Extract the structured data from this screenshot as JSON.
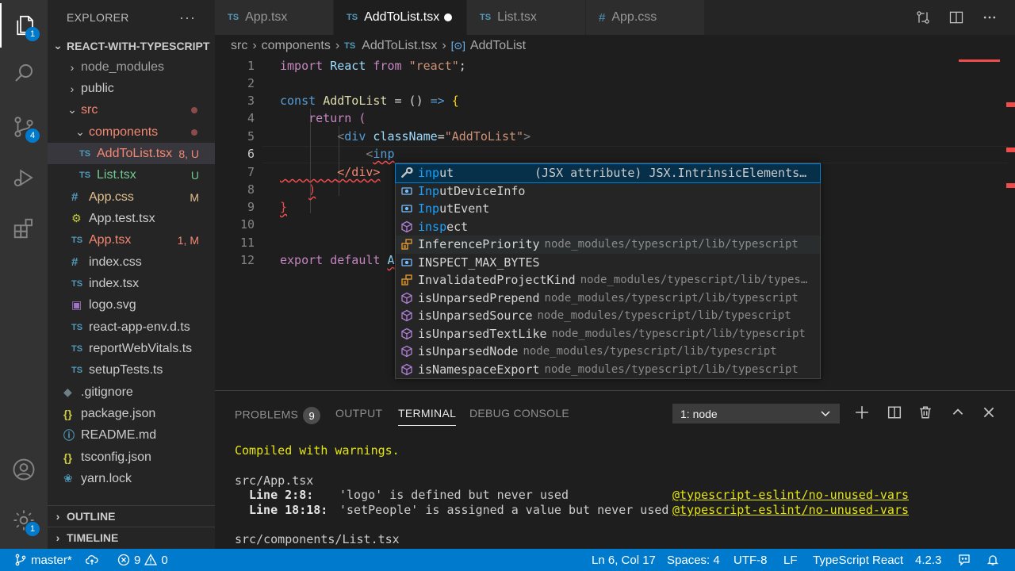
{
  "activity": {
    "explorer_badge": "1",
    "scm_badge": "4",
    "settings_badge": "1"
  },
  "sidebar": {
    "title": "EXPLORER",
    "more": "···",
    "root": "REACT-WITH-TYPESCRIPT",
    "items": [
      {
        "label": "node_modules",
        "type": "folder",
        "status": ""
      },
      {
        "label": "public",
        "type": "folder",
        "status": ""
      },
      {
        "label": "src",
        "type": "folder",
        "status": ""
      },
      {
        "label": "components",
        "type": "folder",
        "status": ""
      },
      {
        "label": "AddToList.tsx",
        "icon": "TS",
        "status": "8, U"
      },
      {
        "label": "List.tsx",
        "icon": "TS",
        "status": "U"
      },
      {
        "label": "App.css",
        "icon": "#",
        "status": "M"
      },
      {
        "label": "App.test.tsx",
        "icon": "gear",
        "status": ""
      },
      {
        "label": "App.tsx",
        "icon": "TS",
        "status": "1, M"
      },
      {
        "label": "index.css",
        "icon": "#",
        "status": ""
      },
      {
        "label": "index.tsx",
        "icon": "TS",
        "status": ""
      },
      {
        "label": "logo.svg",
        "icon": "img",
        "status": ""
      },
      {
        "label": "react-app-env.d.ts",
        "icon": "TS",
        "status": ""
      },
      {
        "label": "reportWebVitals.ts",
        "icon": "TS",
        "status": ""
      },
      {
        "label": "setupTests.ts",
        "icon": "TS",
        "status": ""
      },
      {
        "label": ".gitignore",
        "icon": "git",
        "status": ""
      },
      {
        "label": "package.json",
        "icon": "{}",
        "status": ""
      },
      {
        "label": "README.md",
        "icon": "i",
        "status": ""
      },
      {
        "label": "tsconfig.json",
        "icon": "{}",
        "status": ""
      },
      {
        "label": "yarn.lock",
        "icon": "yarn",
        "status": ""
      }
    ],
    "outline": "OUTLINE",
    "timeline": "TIMELINE"
  },
  "tabs": [
    {
      "icon": "TS",
      "label": "App.tsx"
    },
    {
      "icon": "TS",
      "label": "AddToList.tsx"
    },
    {
      "icon": "TS",
      "label": "List.tsx"
    },
    {
      "icon": "#",
      "label": "App.css"
    }
  ],
  "breadcrumb": {
    "part1": "src",
    "part2": "components",
    "part3": "AddToList.tsx",
    "part4": "AddToList",
    "ts": "TS"
  },
  "editor": {
    "line_numbers": [
      "1",
      "2",
      "3",
      "4",
      "5",
      "6",
      "7",
      "8",
      "9",
      "10",
      "11",
      "12"
    ]
  },
  "suggest": {
    "items": [
      {
        "label_hl": "inp",
        "label_rest": "ut",
        "type": "(JSX attribute) JSX.IntrinsicElements…",
        "kind": "wrench"
      },
      {
        "label_hl": "Inp",
        "label_rest": "utDeviceInfo",
        "detail": "",
        "kind": "var"
      },
      {
        "label_hl": "Inp",
        "label_rest": "utEvent",
        "detail": "",
        "kind": "var"
      },
      {
        "label_hl": "insp",
        "label_rest": "ect",
        "detail": "",
        "kind": "cube"
      },
      {
        "label": "InferencePriority",
        "detail": "node_modules/typescript/lib/typescript",
        "kind": "enum"
      },
      {
        "label": "INSPECT_MAX_BYTES",
        "detail": "",
        "kind": "var"
      },
      {
        "label": "InvalidatedProjectKind",
        "detail": "node_modules/typescript/lib/types…",
        "kind": "enum"
      },
      {
        "label": "isUnparsedPrepend",
        "detail": "node_modules/typescript/lib/typescript",
        "kind": "cube"
      },
      {
        "label": "isUnparsedSource",
        "detail": "node_modules/typescript/lib/typescript",
        "kind": "cube"
      },
      {
        "label": "isUnparsedTextLike",
        "detail": "node_modules/typescript/lib/typescript",
        "kind": "cube"
      },
      {
        "label": "isUnparsedNode",
        "detail": "node_modules/typescript/lib/typescript",
        "kind": "cube"
      },
      {
        "label": "isNamespaceExport",
        "detail": "node_modules/typescript/lib/typescript",
        "kind": "cube"
      }
    ]
  },
  "panel": {
    "problems": "PROBLEMS",
    "problems_count": "9",
    "output": "OUTPUT",
    "terminal": "TERMINAL",
    "debug": "DEBUG CONSOLE",
    "terminal_select": "1: node",
    "lines": {
      "compiled": "Compiled with warnings.",
      "file1": "src/App.tsx",
      "l1_loc": "Line 2:8:",
      "l1_msg": "'logo' is defined but never used",
      "l1_rule": "@typescript-eslint/no-unused-vars",
      "l2_loc": "Line 18:18:",
      "l2_msg": "'setPeople' is assigned a value but never used",
      "l2_rule": "@typescript-eslint/no-unused-vars",
      "file2": "src/components/List.tsx"
    }
  },
  "statusbar": {
    "branch": "master*",
    "errors": "9",
    "warnings": "0",
    "position": "Ln 6, Col 17",
    "spaces": "Spaces: 4",
    "encoding": "UTF-8",
    "eol": "LF",
    "language": "TypeScript React",
    "version": "4.2.3"
  }
}
